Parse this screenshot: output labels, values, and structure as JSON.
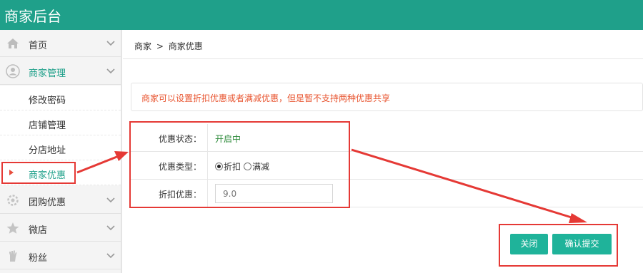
{
  "app": {
    "title": "商家后台"
  },
  "sidebar": {
    "items": [
      {
        "label": "首页",
        "icon": "home-icon"
      },
      {
        "label": "商家管理",
        "icon": "user-icon",
        "active": true
      },
      {
        "label": "团购优惠",
        "icon": "gear-icon"
      },
      {
        "label": "微店",
        "icon": "star-icon"
      },
      {
        "label": "粉丝",
        "icon": "hand-icon"
      }
    ],
    "subitems": [
      {
        "label": "修改密码"
      },
      {
        "label": "店铺管理"
      },
      {
        "label": "分店地址"
      },
      {
        "label": "商家优惠",
        "active": true
      }
    ]
  },
  "breadcrumb": {
    "root": "商家",
    "sep": ">",
    "current": "商家优惠"
  },
  "notice": "商家可以设置折扣优惠或者满减优惠，但是暂不支持两种优惠共享",
  "form": {
    "status_label": "优惠状态：",
    "status_value": "开启中",
    "type_label": "优惠类型：",
    "type_options": [
      "折扣",
      "满减"
    ],
    "type_selected": "折扣",
    "discount_label": "折扣优惠：",
    "discount_placeholder": "9.0"
  },
  "buttons": {
    "close": "关闭",
    "submit": "确认提交"
  },
  "colors": {
    "brand": "#1fa08a",
    "button": "#1fb39a",
    "highlight": "#e53935",
    "notice": "#e8542f",
    "status_on": "#2e8b3b"
  }
}
